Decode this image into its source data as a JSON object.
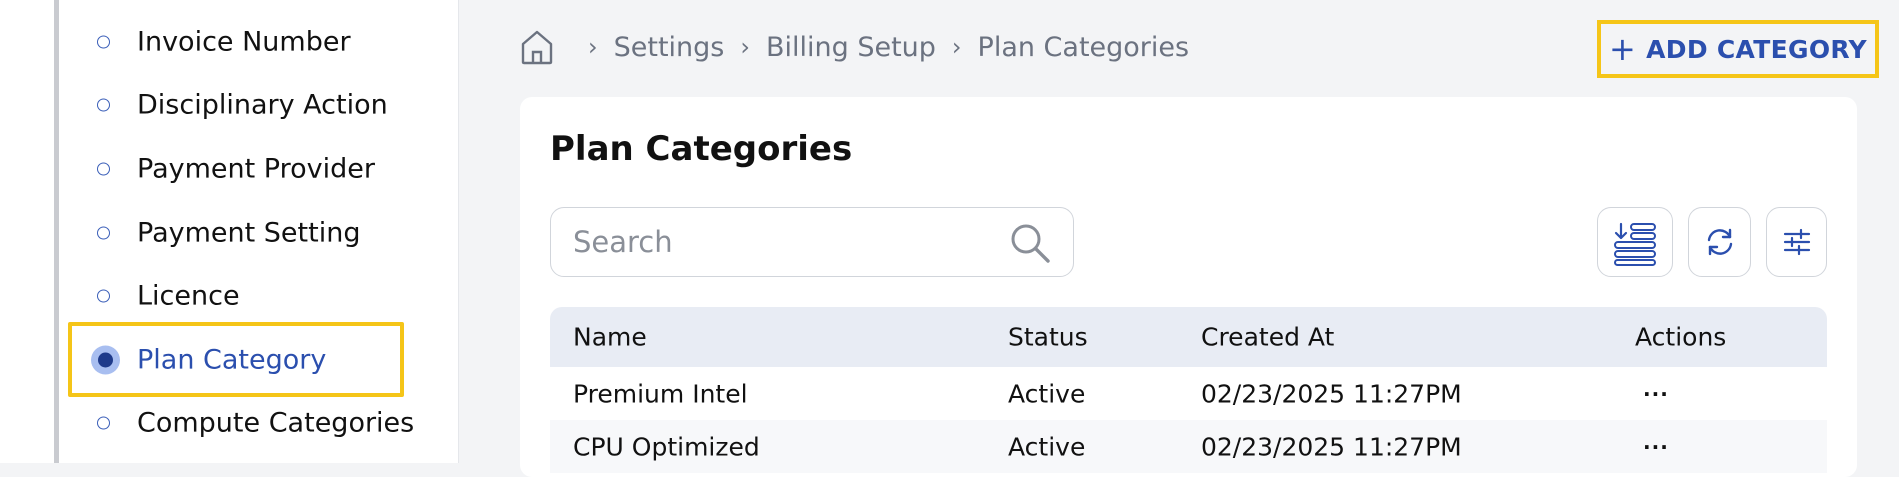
{
  "sidebar": {
    "items": [
      {
        "label": "Invoice Number",
        "active": false
      },
      {
        "label": "Disciplinary Action",
        "active": false
      },
      {
        "label": "Payment Provider",
        "active": false
      },
      {
        "label": "Payment Setting",
        "active": false
      },
      {
        "label": "Licence",
        "active": false
      },
      {
        "label": "Plan Category",
        "active": true
      },
      {
        "label": "Compute Categories",
        "active": false
      }
    ]
  },
  "breadcrumb": {
    "home_icon": "home-icon",
    "items": [
      "Settings",
      "Billing Setup",
      "Plan Categories"
    ]
  },
  "header": {
    "add_button_label": "ADD CATEGORY",
    "add_icon": "plus-icon"
  },
  "main": {
    "title": "Plan Categories",
    "search": {
      "placeholder": "Search",
      "icon": "search-icon"
    },
    "toolbar": [
      "export-list-icon",
      "refresh-icon",
      "filter-sliders-icon"
    ],
    "table": {
      "columns": [
        "Name",
        "Status",
        "Created At",
        "Actions"
      ],
      "rows": [
        {
          "name": "Premium Intel",
          "status": "Active",
          "created_at": "02/23/2025 11:27PM",
          "actions": "···"
        },
        {
          "name": "CPU Optimized",
          "status": "Active",
          "created_at": "02/23/2025 11:27PM",
          "actions": "···"
        }
      ]
    }
  },
  "colors": {
    "accent": "#2b4fae",
    "highlight": "#f5c518"
  }
}
